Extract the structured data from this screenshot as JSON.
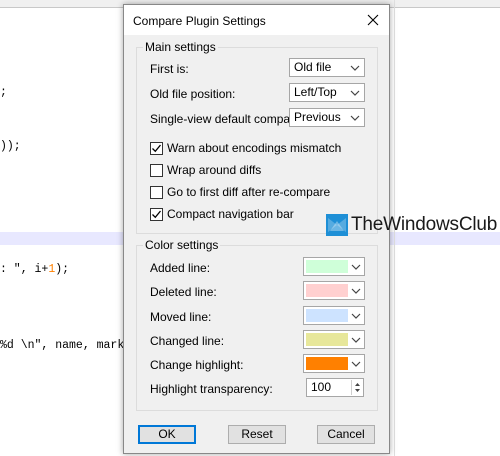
{
  "editor": {
    "lines": [
      ";",
      "));",
      ": \", i+1);",
      "%d \\n\", name, marks"
    ],
    "line3_prefix": ": \", i+",
    "line3_num": "1",
    "line3_suffix": ");"
  },
  "dialog": {
    "title": "Compare Plugin Settings",
    "close_glyph": "✕",
    "main": {
      "legend": "Main settings",
      "first_is_label": "First is:",
      "first_is_value": "Old file",
      "position_label": "Old file position:",
      "position_value": "Left/Top",
      "single_view_label": "Single-view default compare to:",
      "single_view_value": "Previous",
      "checkboxes": [
        {
          "label": "Warn about encodings mismatch",
          "checked": true
        },
        {
          "label": "Wrap around diffs",
          "checked": false
        },
        {
          "label": "Go to first diff after re-compare",
          "checked": false
        },
        {
          "label": "Compact navigation bar",
          "checked": true
        }
      ]
    },
    "colors": {
      "legend": "Color settings",
      "items": [
        {
          "label": "Added line:",
          "color": "#cfffd9"
        },
        {
          "label": "Deleted line:",
          "color": "#ffd0d0"
        },
        {
          "label": "Moved line:",
          "color": "#cde3ff"
        },
        {
          "label": "Changed line:",
          "color": "#e7e79a"
        },
        {
          "label": "Change highlight:",
          "color": "#ff8000"
        }
      ],
      "transparency_label": "Highlight transparency:",
      "transparency_value": "100"
    },
    "buttons": {
      "ok": "OK",
      "reset": "Reset",
      "cancel": "Cancel"
    }
  },
  "watermark": {
    "text": "TheWindowsClub",
    "logo_color": "#1e8fd6"
  }
}
